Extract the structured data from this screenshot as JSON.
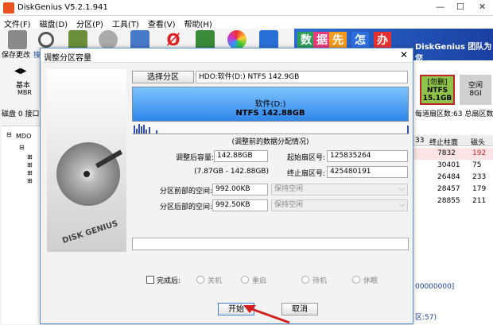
{
  "app": {
    "title": "DiskGenius V5.2.1.941"
  },
  "menu": [
    "文件(F)",
    "磁盘(D)",
    "分区(P)",
    "工具(T)",
    "查看(V)",
    "帮助(H)"
  ],
  "toolbar": {
    "save_label": "保存更改",
    "search_label": "搜"
  },
  "banner": {
    "blocks": [
      "数",
      "据",
      "先",
      "怎",
      "办"
    ],
    "text": "DiskGenius 团队为您"
  },
  "background": {
    "basic_label": "基本",
    "mbr_label": "MBR",
    "disk_label": "磁盘 0 接口",
    "right_part_label": "[勿删]",
    "right_fs": "NTFS",
    "right_size": "15.1GB",
    "right_extra": "空闲",
    "right_extra2": "8GI",
    "right_header": "每道扇区数:63 总扇区数",
    "col1": "33",
    "col2": "终止柱面",
    "col3": "磁头",
    "rows": [
      [
        "7832",
        "192"
      ],
      [
        "30401",
        "75"
      ],
      [
        "26484",
        "233"
      ],
      [
        "28457",
        "179"
      ],
      [
        "28855",
        "211"
      ]
    ],
    "frag1": "00000000]",
    "frag2": "区:57)",
    "frag3": "MDO"
  },
  "dialog": {
    "title": "调整分区容量",
    "select_partition_button": "选择分区",
    "partition_info": "HDO:软件(D:) NTFS 142.9GB",
    "bar_name": "软件(D:)",
    "bar_fs": "NTFS 142.88GB",
    "section_title": "(调整前的数据分配情况)",
    "size_after_label": "调整后容量:",
    "size_after_value": "142.88GB",
    "size_range": "(7.87GB - 142.88GB)",
    "start_sector_label": "起始扇区号:",
    "start_sector_value": "125835264",
    "end_sector_label": "终止扇区号:",
    "end_sector_value": "425480191",
    "before_space_label": "分区前部的空间:",
    "before_space_value": "992.00KB",
    "before_space_option": "保持空闲",
    "after_space_label": "分区后部的空间:",
    "after_space_value": "992.50KB",
    "after_space_option": "保持空闲",
    "on_finish_label": "完成后:",
    "options": [
      "关机",
      "重启",
      "待机",
      "休眠"
    ],
    "start_button": "开始",
    "cancel_button": "取消"
  }
}
